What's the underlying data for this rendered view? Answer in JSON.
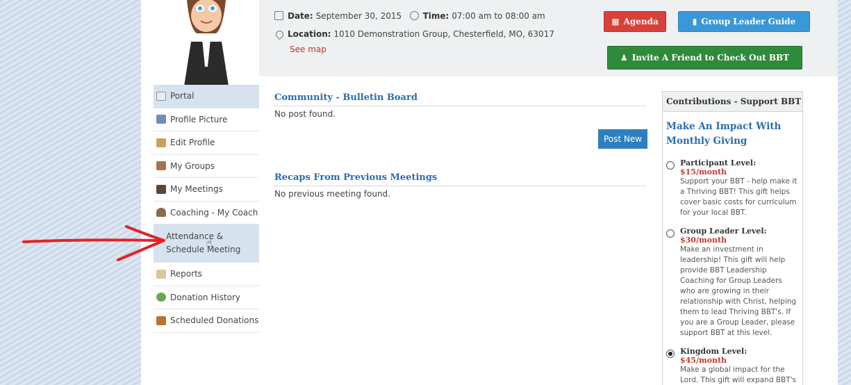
{
  "header": {
    "date_label": "Date:",
    "date_value": "September 30, 2015",
    "time_label": "Time:",
    "time_value": "07:00 am to 08:00 am",
    "location_label": "Location:",
    "location_value": "1010 Demonstration Group, Chesterfield, MO, 63017",
    "see_map": "See map"
  },
  "buttons": {
    "agenda": "Agenda",
    "group_leader_guide": "Group Leader Guide",
    "invite": "Invite A Friend to Check Out BBT"
  },
  "sidebar": {
    "items": [
      {
        "label": "Portal",
        "icon": "portal-icon"
      },
      {
        "label": "Profile Picture",
        "icon": "profile-picture-icon"
      },
      {
        "label": "Edit Profile",
        "icon": "edit-profile-icon"
      },
      {
        "label": "My Groups",
        "icon": "groups-icon"
      },
      {
        "label": "My Meetings",
        "icon": "meetings-icon"
      },
      {
        "label": "Coaching - My Coach",
        "icon": "coach-icon"
      },
      {
        "label": "Attendance & Schedule Meeting",
        "icon": ""
      },
      {
        "label": "Reports",
        "icon": "reports-icon"
      },
      {
        "label": "Donation History",
        "icon": "donation-history-icon"
      },
      {
        "label": "Scheduled Donations",
        "icon": "scheduled-donations-icon"
      }
    ]
  },
  "main": {
    "bulletin_title": "Community - Bulletin Board",
    "bulletin_empty": "No post found.",
    "post_new": "Post New",
    "recaps_title": "Recaps From Previous Meetings",
    "recaps_empty": "No previous meeting found."
  },
  "contributions": {
    "title": "Contributions - Support BBT",
    "subtitle": "Make An Impact With Monthly Giving",
    "levels": [
      {
        "name": "Participant Level:",
        "price": "$15/month",
        "desc": "Support your BBT - help make it a Thriving BBT! This gift helps cover basic costs for curriculum for your local BBT.",
        "selected": false
      },
      {
        "name": "Group Leader Level:",
        "price": "$30/month",
        "desc": "Make an investment in leadership! This gift will help provide BBT Leadership Coaching for Group Leaders who are growing in their relationship with Christ, helping them to lead Thriving BBT's. If you are a Group Leader, please support BBT at this level.",
        "selected": false
      },
      {
        "name": "Kingdom Level:",
        "price": "$45/month",
        "desc": "Make a global impact for the Lord. This gift will expand BBT's reach. How",
        "selected": true
      }
    ]
  },
  "colors": {
    "agenda": "#d9403a",
    "guide": "#3a98d8",
    "invite": "#2e8b3a",
    "link_blue": "#2b6cb0",
    "price_red": "#c0392b",
    "annotation_arrow": "#e02424"
  }
}
